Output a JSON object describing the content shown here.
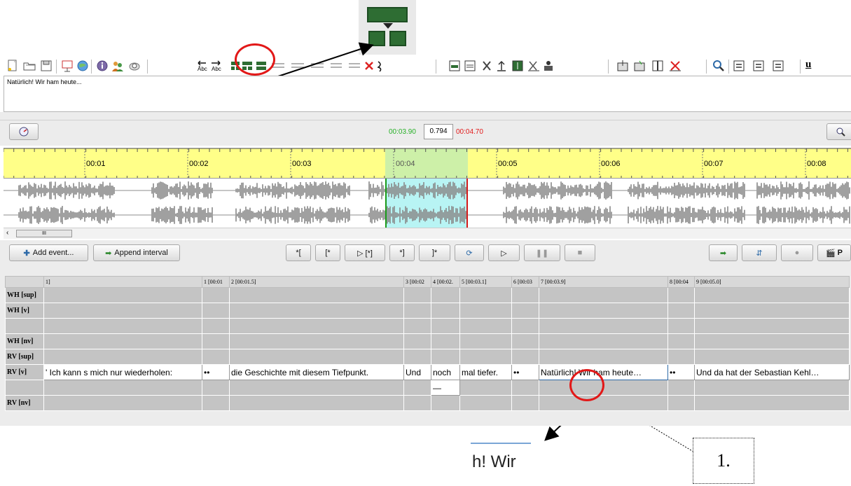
{
  "toolbar": {
    "colors": {
      "accent_green": "#2e6d33",
      "highlight_red": "#e21818"
    },
    "icons": [
      "new-file-icon",
      "open-folder-icon",
      "save-icon",
      "export-icon",
      "web-icon",
      "info-icon",
      "speakers-icon",
      "search-disk-icon",
      "move-left-icon",
      "move-right-icon",
      "split-event-icon",
      "merge-event-icon",
      "shift-left-icon",
      "shift-right-icon",
      "collapse-icon",
      "expand-icon",
      "delete-event-icon",
      "scissors-icon",
      "insert-tier-icon",
      "tier-arrow-icon",
      "remove-tier-icon",
      "up-tier-icon",
      "edit-tier-icon",
      "close-tier-icon",
      "speaker-icon",
      "import-icon",
      "merge-icon",
      "column-icon",
      "remove-icon",
      "find-icon",
      "view1-icon",
      "view2-icon",
      "view3-icon",
      "underline-icon"
    ],
    "underline_label": "u"
  },
  "text_preview": "Natürlich! Wir ham heute...",
  "timeline": {
    "start_time": "00:03.90",
    "duration": "0.794",
    "end_time": "00:04.70",
    "ticks": [
      "00:01",
      "00:02",
      "00:03",
      "00:04",
      "00:05",
      "00:06",
      "00:07",
      "00:08"
    ]
  },
  "scroll": {
    "thumb_label": "III"
  },
  "controls": {
    "add_event": "Add event...",
    "append_interval": "Append interval",
    "play_buttons": [
      "*[",
      "[*",
      "▷ [*]",
      "*]",
      "]*"
    ],
    "right_label": "P"
  },
  "grid": {
    "header": [
      "1]",
      "1 [00:01",
      "2 [00:01.5]",
      "3 [00:02",
      "4 [00:02.",
      "5 [00:03.1]",
      "6 [00:03",
      "7 [00:03.9]",
      "8 [00:04",
      "9 [00:05.0]"
    ],
    "tiers": [
      "WH [sup]",
      "WH [v]",
      "",
      "WH [nv]",
      "RV [sup]",
      "RV [v]",
      "",
      "RV [nv]"
    ],
    "rv_v_cells": [
      "' Ich kann s mich nur wiederholen:",
      "••",
      "die Geschichte mit diesem Tiefpunkt.",
      "Und",
      "noch",
      "mal tiefer.",
      "••",
      "Natürlich! Wir ham heute…",
      "••",
      "Und da hat der Sebastian Kehl…"
    ],
    "dash_cell": "—"
  },
  "magnify_text": "h! Wir",
  "annotation_label": "1."
}
